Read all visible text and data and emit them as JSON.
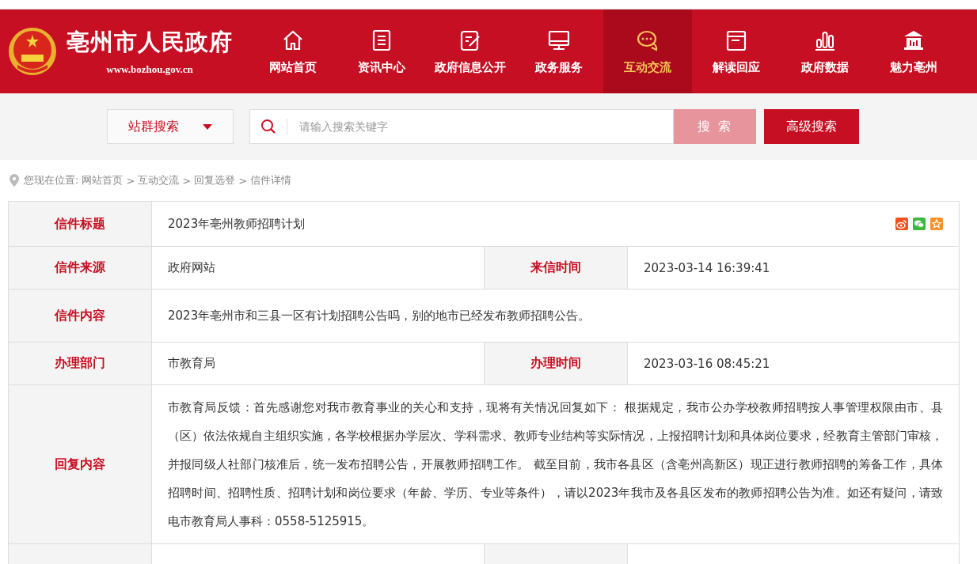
{
  "header": {
    "site_title": "亳州市人民政府",
    "site_url": "www.bozhou.gov.cn",
    "nav": [
      {
        "label": "网站首页",
        "kind": "home",
        "selected": false
      },
      {
        "label": "资讯中心",
        "kind": "news",
        "selected": false
      },
      {
        "label": "政府信息公开",
        "kind": "edit",
        "selected": false
      },
      {
        "label": "政务服务",
        "kind": "monitor",
        "selected": false
      },
      {
        "label": "互动交流",
        "kind": "chat",
        "selected": true
      },
      {
        "label": "解读回应",
        "kind": "folder",
        "selected": false
      },
      {
        "label": "政府数据",
        "kind": "bars",
        "selected": false
      },
      {
        "label": "魅力亳州",
        "kind": "building",
        "selected": false
      }
    ]
  },
  "search": {
    "scope_label": "站群搜索",
    "placeholder": "请输入搜索关键字",
    "search_button": "搜 索",
    "advanced_button": "高级搜索"
  },
  "breadcrumb": {
    "prefix": "您现在位置:",
    "separator": ">",
    "crumbs": [
      "网站首页",
      "互动交流",
      "回复选登",
      "信件详情"
    ]
  },
  "letter": {
    "rows": [
      {
        "kind": "title",
        "label": "信件标题",
        "value": "2023年亳州教师招聘计划"
      },
      {
        "kind": "split",
        "label": "信件来源",
        "value": "政府网站",
        "label_2": "来信时间",
        "value_2": "2023-03-14 16:39:41"
      },
      {
        "kind": "wide",
        "label": "信件内容",
        "value": "2023年亳州市和三县一区有计划招聘公告吗，别的地市已经发布教师招聘公告。"
      },
      {
        "kind": "split",
        "label": "办理部门",
        "value": "市教育局",
        "label_2": "办理时间",
        "value_2": "2023-03-16 08:45:21"
      },
      {
        "kind": "wide",
        "label": "回复内容",
        "value": "市教育局反馈：首先感谢您对我市教育事业的关心和支持，现将有关情况回复如下： 根据规定，我市公办学校教师招聘按人事管理权限由市、县（区）依法依规自主组织实施，各学校根据办学层次、学科需求、教师专业结构等实际情况，上报招聘计划和具体岗位要求，经教育主管部门审核，并报同级人社部门核准后，统一发布招聘公告，开展教师招聘工作。 截至目前，我市各县区（含亳州高新区）现正进行教师招聘的筹备工作，具体招聘时间、招聘性质、招聘计划和岗位要求（年龄、学历、专业等条件），请以2023年我市及各县区发布的教师招聘公告为准。如还有疑问，请致电市教育局人事科：0558-5125915。"
      },
      {
        "kind": "blank"
      }
    ]
  }
}
